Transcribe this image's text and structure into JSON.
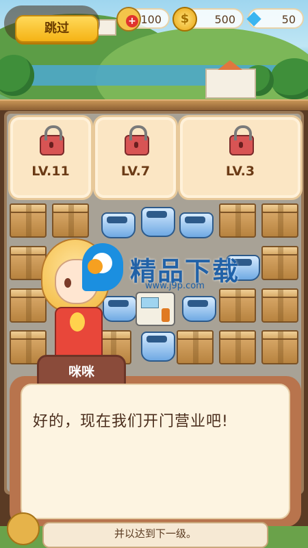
{
  "hud": {
    "skip_label": "跳过",
    "energy": "100",
    "coins": "500",
    "gems": "50"
  },
  "locked_slots": [
    {
      "level": "LV.11"
    },
    {
      "level": "LV.7"
    },
    {
      "level": "LV.3"
    }
  ],
  "watermark": {
    "brand": "精品下载",
    "url": "www.j9p.com"
  },
  "dialog": {
    "speaker": "咪咪",
    "text": "好的，现在我们开门营业吧!"
  },
  "hint_text": "并以达到下一级。",
  "colors": {
    "accent": "#f5b315",
    "board": "#9b7a58",
    "dialog_bg": "#fdf4e1",
    "name_tag": "#8a4b3a"
  }
}
